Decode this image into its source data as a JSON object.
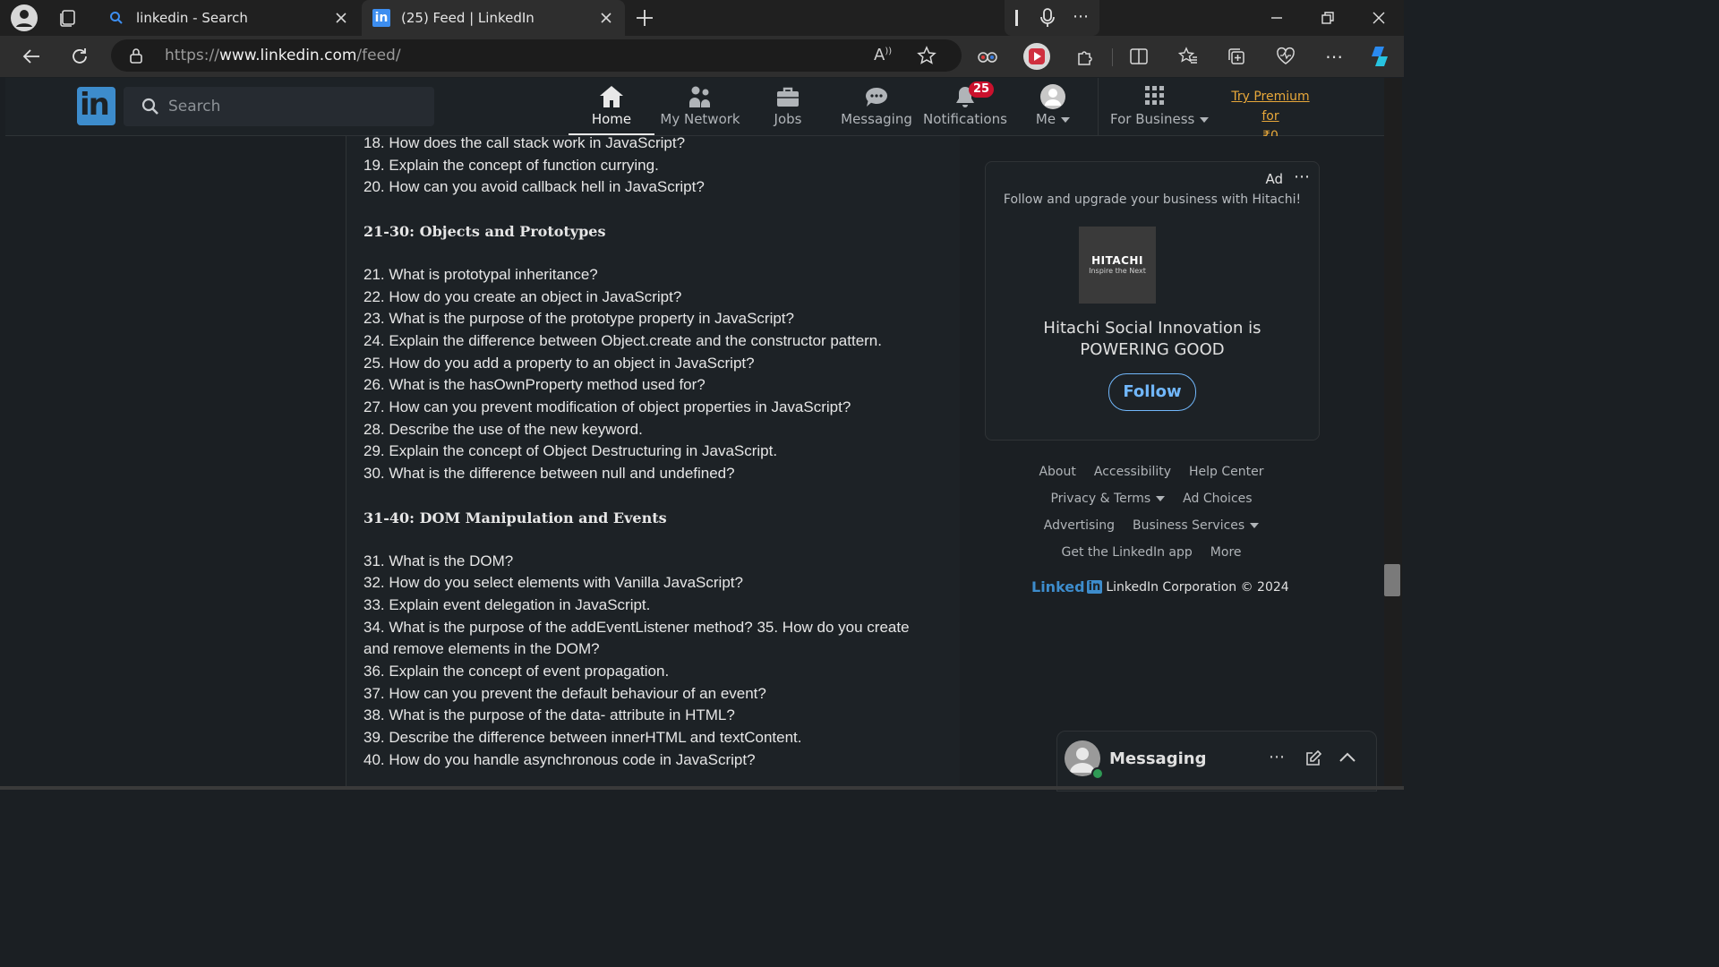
{
  "browser": {
    "tabs": [
      {
        "title": "linkedin - Search",
        "icon": "search-icon"
      },
      {
        "title": "(25) Feed | LinkedIn",
        "icon": "linkedin-icon"
      }
    ],
    "url_prefix": "https://",
    "url_host": "www.linkedin.com",
    "url_path": "/feed/"
  },
  "nav": {
    "search_placeholder": "Search",
    "items": [
      {
        "label": "Home",
        "icon": "home-icon"
      },
      {
        "label": "My Network",
        "icon": "network-icon"
      },
      {
        "label": "Jobs",
        "icon": "briefcase-icon"
      },
      {
        "label": "Messaging",
        "icon": "chat-icon"
      },
      {
        "label": "Notifications",
        "icon": "bell-icon",
        "badge": "25"
      },
      {
        "label": "Me",
        "icon": "avatar"
      },
      {
        "label": "For Business",
        "icon": "grid-icon"
      }
    ],
    "premium_line1": "Try Premium for",
    "premium_line2": "₹0"
  },
  "post": {
    "group1": [
      "18. How does the call stack work in JavaScript?",
      "19. Explain the concept of function currying.",
      "20. How can you avoid callback hell in JavaScript?"
    ],
    "section2": "21-30: Objects and Prototypes",
    "group2": [
      "21. What is prototypal inheritance?",
      "22. How do you create an object in JavaScript?",
      "23. What is the purpose of the prototype property in JavaScript?",
      "24. Explain the difference between Object.create and the constructor pattern.",
      "25. How do you add a property to an object in JavaScript?",
      "26. What is the hasOwnProperty method used for?",
      "27. How can you prevent modification of object properties in JavaScript?",
      "28. Describe the use of the new keyword.",
      "29. Explain the concept of Object Destructuring in JavaScript.",
      "30. What is the difference between null and undefined?"
    ],
    "section3": "31-40: DOM Manipulation and Events",
    "group3": [
      "31. What is the DOM?",
      "32. How do you select elements with Vanilla JavaScript?",
      "33. Explain event delegation in JavaScript.",
      "34. What is the purpose of the addEventListener method? 35. How do you create and remove elements in the DOM?",
      "36. Explain the concept of event propagation.",
      "37. How can you prevent the default behaviour of an event?",
      "38. What is the purpose of the data- attribute in HTML?",
      "39. Describe the difference between innerHTML and textContent.",
      "40. How do you handle asynchronous code in JavaScript?"
    ]
  },
  "ad": {
    "tag": "Ad",
    "text": "Follow and upgrade your business with Hitachi!",
    "logo_name": "HITACHI",
    "logo_tagline": "Inspire the Next",
    "headline": "Hitachi Social Innovation is POWERING GOOD",
    "follow_label": "Follow"
  },
  "footer": {
    "about": "About",
    "accessibility": "Accessibility",
    "help": "Help Center",
    "privacy": "Privacy & Terms",
    "adchoices": "Ad Choices",
    "advertising": "Advertising",
    "business": "Business Services",
    "getapp": "Get the LinkedIn app",
    "more": "More",
    "wordmark": "Linked",
    "wordmark_in": "in",
    "copyright": "LinkedIn Corporation © 2024"
  },
  "messaging": {
    "title": "Messaging"
  },
  "colors": {
    "accent": "#71b7fb",
    "brand": "#3d8ccc",
    "badge": "#cb112d",
    "premium": "#e8a83a"
  }
}
